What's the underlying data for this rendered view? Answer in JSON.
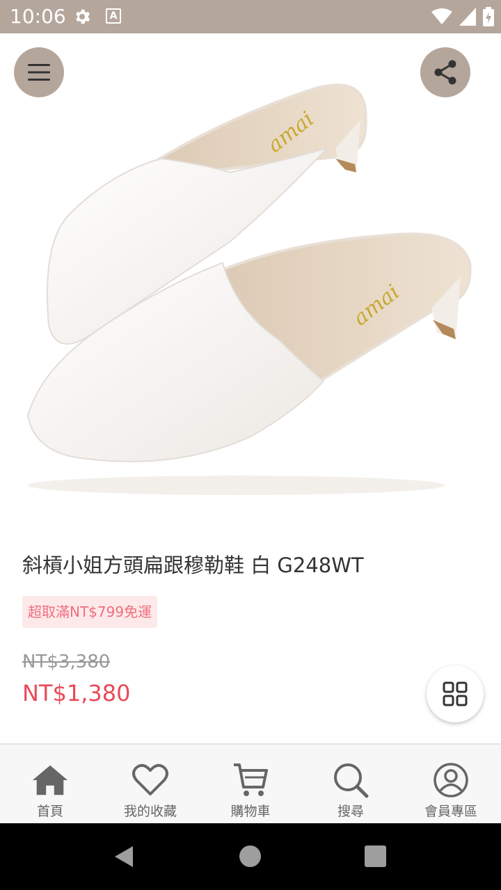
{
  "status_bar": {
    "time": "10:06",
    "icons": [
      "gear-icon",
      "a-notification-icon",
      "wifi-icon",
      "signal-icon",
      "battery-charging-icon"
    ],
    "notification_letter": "A",
    "background": "#b5a69c"
  },
  "hero": {
    "icons": [
      "menu-icon",
      "share-icon"
    ],
    "logo_text": "amai"
  },
  "product": {
    "title": "斜槓小姐方頭扁跟穆勒鞋 白 G248WT",
    "shipping_badge": "超取滿NT$799免運",
    "original_price": "NT$3,380",
    "sale_price": "NT$1,380",
    "sale_color": "#e84a58"
  },
  "bottom_nav": {
    "items": [
      {
        "label": "首頁",
        "icon": "home-icon"
      },
      {
        "label": "我的收藏",
        "icon": "heart-icon"
      },
      {
        "label": "購物車",
        "icon": "cart-icon"
      },
      {
        "label": "搜尋",
        "icon": "search-icon"
      },
      {
        "label": "會員專區",
        "icon": "user-icon"
      }
    ]
  },
  "android_nav": {
    "icons": [
      "back-icon",
      "home-circle-icon",
      "recent-apps-icon"
    ]
  }
}
